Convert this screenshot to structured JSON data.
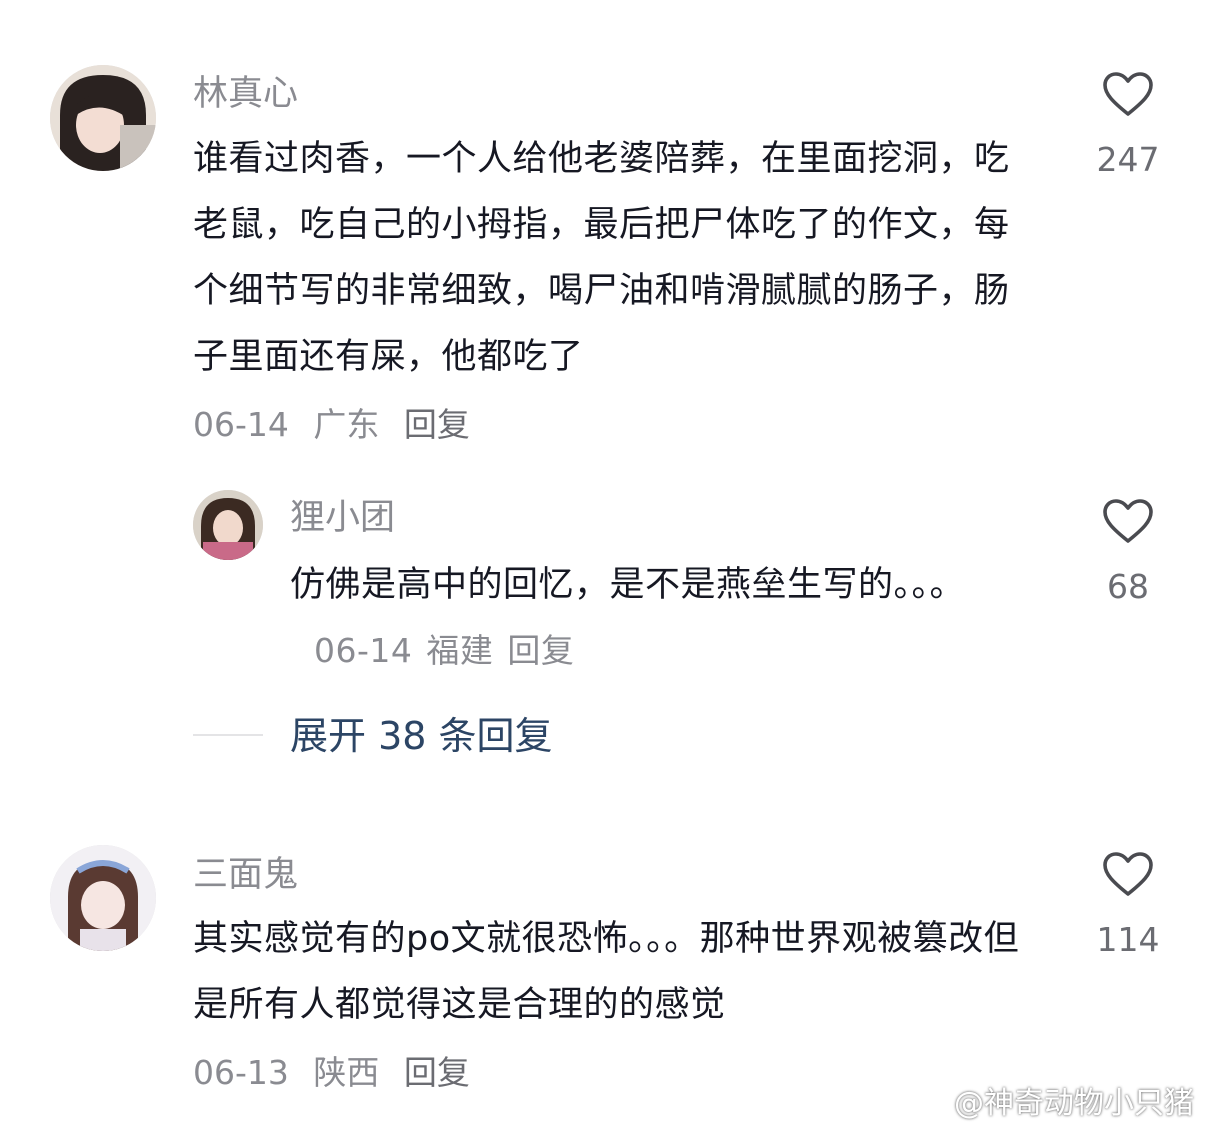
{
  "comments": [
    {
      "username": "林真心",
      "text": "谁看过肉香，一个人给他老婆陪葬，在里面挖洞，吃老鼠，吃自己的小拇指，最后把尸体吃了的作文，每个细节写的非常细致，喝尸油和啃滑腻腻的肠子，肠子里面还有屎，他都吃了",
      "date": "06-14",
      "location": "广东",
      "reply_label": "回复",
      "likes": "247",
      "replies": [
        {
          "username": "狸小团",
          "text": "仿佛是高中的回忆，是不是燕垒生写的。。。",
          "date": "06-14",
          "location": "福建",
          "reply_label": "回复",
          "likes": "68"
        }
      ],
      "expand_label": "展开 38 条回复"
    },
    {
      "username": "三面鬼",
      "text": "其实感觉有的po文就很恐怖。。。那种世界观被篡改但是所有人都觉得这是合理的的感觉",
      "date": "06-13",
      "location": "陕西",
      "reply_label": "回复",
      "likes": "114"
    }
  ],
  "watermark": "@神奇动物小只猪",
  "icons": {
    "like": "heart-outline-icon",
    "watermark_logo": "weibo-logo-icon"
  },
  "colors": {
    "text": "#161823",
    "muted": "#8a8b91",
    "expand": "#2c4565"
  }
}
